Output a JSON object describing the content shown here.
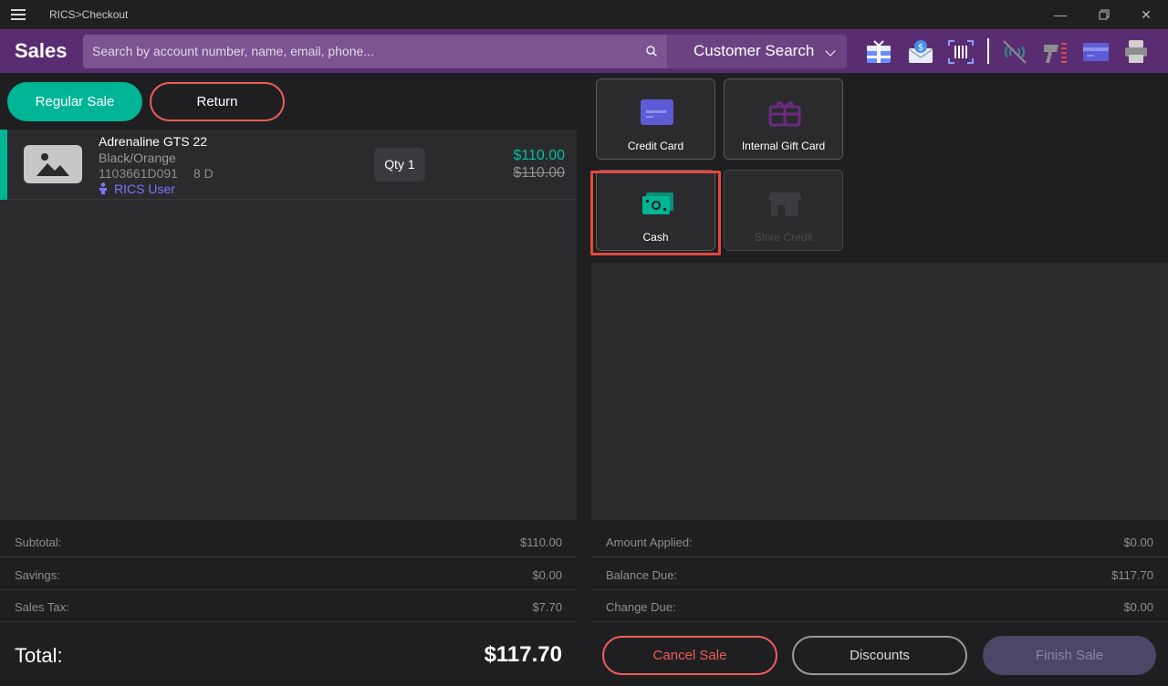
{
  "window": {
    "title": "RICS>Checkout"
  },
  "appbar": {
    "title": "Sales",
    "search_placeholder": "Search by account number, name, email, phone...",
    "search_mode": "Customer Search",
    "toolbar_icons": [
      "gift-receipt-icon",
      "email-receipt-icon",
      "barcode-scanner-icon",
      "nfc-disabled-icon",
      "scanner-gun-icon",
      "card-reader-icon",
      "printer-icon"
    ]
  },
  "tabs": {
    "regular": "Regular Sale",
    "return": "Return"
  },
  "cart": {
    "items": [
      {
        "name": "Adrenaline GTS 22",
        "color": "Black/Orange",
        "sku": "1103661D091",
        "size": "8  D",
        "user": "RICS User",
        "qty": "Qty 1",
        "price": "$110.00",
        "original_price": "$110.00"
      }
    ]
  },
  "totals": {
    "subtotal_label": "Subtotal:",
    "subtotal": "$110.00",
    "savings_label": "Savings:",
    "savings": "$0.00",
    "tax_label": "Sales Tax:",
    "tax": "$7.70",
    "total_label": "Total:",
    "total": "$117.70"
  },
  "payment_methods": [
    {
      "label": "Credit Card",
      "icon": "credit-card-icon",
      "enabled": true
    },
    {
      "label": "Internal Gift Card",
      "icon": "gift-card-icon",
      "enabled": true
    },
    {
      "label": "Cash",
      "icon": "cash-icon",
      "enabled": true,
      "highlighted": true
    },
    {
      "label": "Store Credit",
      "icon": "store-icon",
      "enabled": false
    }
  ],
  "payment_summary": {
    "applied_label": "Amount Applied:",
    "applied": "$0.00",
    "balance_label": "Balance Due:",
    "balance": "$117.70",
    "change_label": "Change Due:",
    "change": "$0.00"
  },
  "actions": {
    "cancel": "Cancel Sale",
    "discounts": "Discounts",
    "finish": "Finish Sale"
  },
  "colors": {
    "brand": "#5a2d72",
    "accent": "#00b496",
    "danger": "#ee5e58",
    "link": "#7c76ff"
  }
}
